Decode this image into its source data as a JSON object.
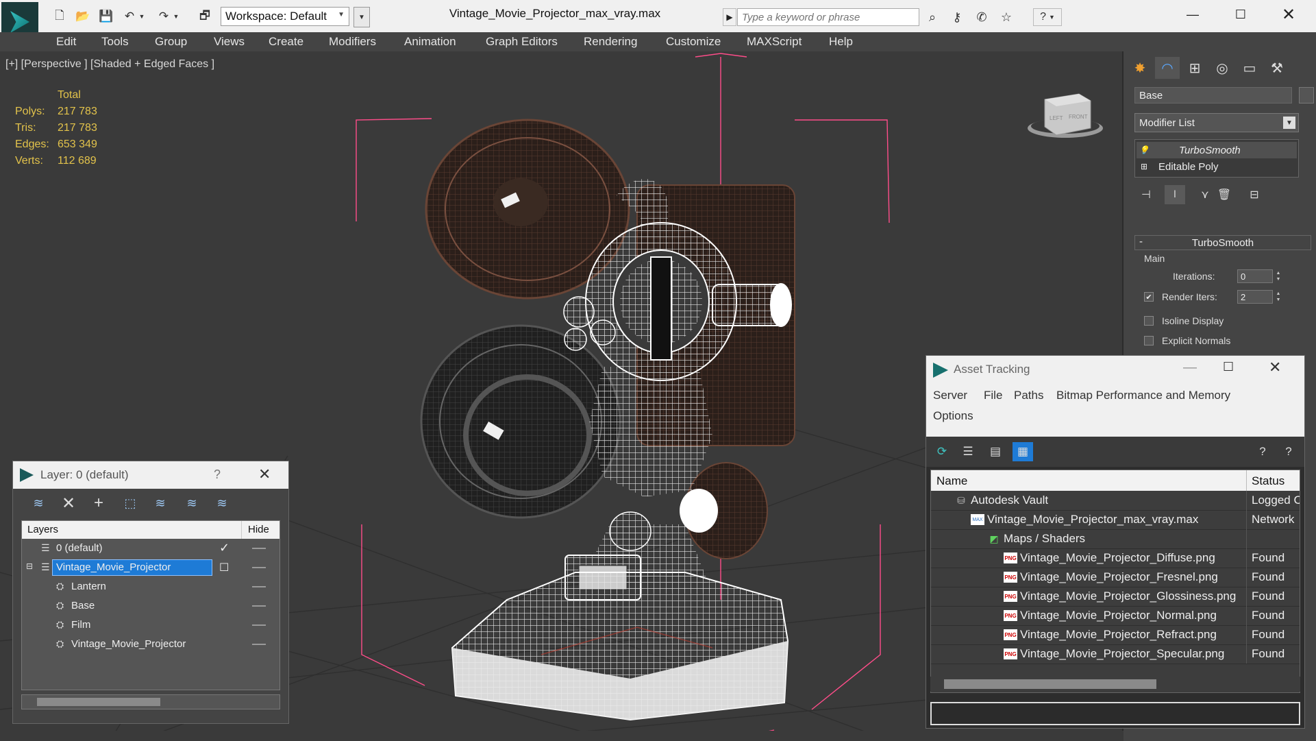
{
  "titlebar": {
    "workspace": "Workspace: Default",
    "title": "Vintage_Movie_Projector_max_vray.max",
    "search_placeholder": "Type a keyword or phrase"
  },
  "menu": [
    "Edit",
    "Tools",
    "Group",
    "Views",
    "Create",
    "Modifiers",
    "Animation",
    "Graph Editors",
    "Rendering",
    "Customize",
    "MAXScript",
    "Help"
  ],
  "viewport": {
    "label": "[+] [Perspective ] [Shaded + Edged Faces ]",
    "stats": {
      "header": "Total",
      "rows": [
        {
          "label": "Polys:",
          "value": "217 783"
        },
        {
          "label": "Tris:",
          "value": "217 783"
        },
        {
          "label": "Edges:",
          "value": "653 349"
        },
        {
          "label": "Verts:",
          "value": "112 689"
        }
      ]
    },
    "viewcube_left": "LEFT",
    "viewcube_front": "FRONT"
  },
  "command_panel": {
    "object_name": "Base",
    "modifier_list": "Modifier List",
    "stack": [
      "TurboSmooth",
      "Editable Poly"
    ],
    "rollout": {
      "title": "TurboSmooth",
      "minus": "-",
      "group": "Main",
      "iterations_label": "Iterations:",
      "iterations_value": "0",
      "render_iters_label": "Render Iters:",
      "render_iters_value": "2",
      "isoline": "Isoline Display",
      "explicit": "Explicit Normals"
    }
  },
  "layer_dialog": {
    "title": "Layer: 0 (default)",
    "help": "?",
    "col_layers": "Layers",
    "col_hide": "Hide",
    "rows": [
      {
        "name": "0 (default)"
      },
      {
        "name": "Vintage_Movie_Projector"
      },
      {
        "name": "Lantern"
      },
      {
        "name": "Base"
      },
      {
        "name": "Film"
      },
      {
        "name": "Vintage_Movie_Projector"
      }
    ]
  },
  "asset_dialog": {
    "title": "Asset Tracking",
    "menu": [
      "Server",
      "File",
      "Paths",
      "Bitmap Performance and Memory",
      "Options"
    ],
    "col_name": "Name",
    "col_status": "Status",
    "rows": [
      {
        "name": "Autodesk Vault",
        "status": "Logged C"
      },
      {
        "name": "Vintage_Movie_Projector_max_vray.max",
        "status": "Network"
      },
      {
        "name": "Maps / Shaders",
        "status": ""
      },
      {
        "name": "Vintage_Movie_Projector_Diffuse.png",
        "status": "Found"
      },
      {
        "name": "Vintage_Movie_Projector_Fresnel.png",
        "status": "Found"
      },
      {
        "name": "Vintage_Movie_Projector_Glossiness.png",
        "status": "Found"
      },
      {
        "name": "Vintage_Movie_Projector_Normal.png",
        "status": "Found"
      },
      {
        "name": "Vintage_Movie_Projector_Refract.png",
        "status": "Found"
      },
      {
        "name": "Vintage_Movie_Projector_Specular.png",
        "status": "Found"
      }
    ],
    "png_badge": "PNG",
    "max_badge": "MAX"
  },
  "colors": {
    "accent": "#1e7bd6",
    "stats": "#e3c34b",
    "selection_box": "#ff4d8a"
  }
}
